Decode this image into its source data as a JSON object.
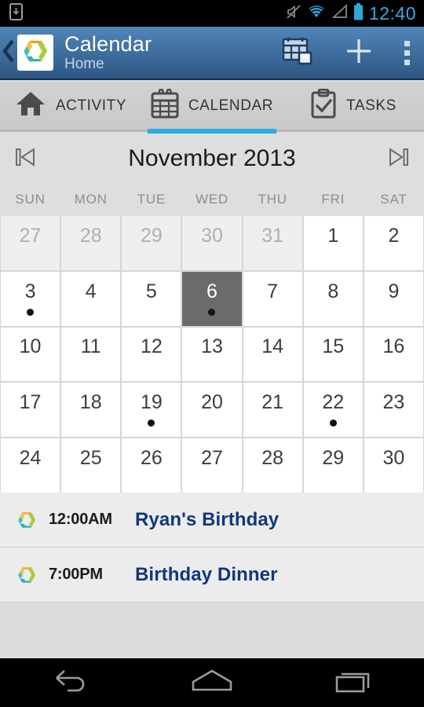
{
  "status_bar": {
    "clock": "12:40",
    "icons": [
      "download-icon",
      "mute-icon",
      "wifi-icon",
      "signal-icon",
      "battery-icon"
    ],
    "clock_color": "#3aabe0"
  },
  "action_bar": {
    "up_icon": "chevron-left-icon",
    "logo_icon": "app-logo-hexagon-icon",
    "title": "Calendar",
    "subtitle": "Home",
    "actions": [
      {
        "name": "month-view-icon",
        "label": "Month view"
      },
      {
        "name": "add-icon",
        "label": "Add"
      },
      {
        "name": "overflow-menu-icon",
        "label": "More options"
      }
    ],
    "gradient_top": "#5185bb",
    "gradient_bottom": "#2f5684"
  },
  "tabs": [
    {
      "id": "activity",
      "label": "ACTIVITY",
      "icon": "home-icon",
      "active": false
    },
    {
      "id": "calendar",
      "label": "CALENDAR",
      "icon": "calendar-icon",
      "active": true
    },
    {
      "id": "tasks",
      "label": "TASKS",
      "icon": "clipboard-check-icon",
      "active": false
    }
  ],
  "tab_indicator_color": "#29abe2",
  "month_bar": {
    "prev_icon": "skip-previous-icon",
    "next_icon": "skip-next-icon",
    "title": "November 2013"
  },
  "weekdays": [
    "SUN",
    "MON",
    "TUE",
    "WED",
    "THU",
    "FRI",
    "SAT"
  ],
  "calendar": {
    "selected_day": 6,
    "selected_bg": "#6b6b6b",
    "weeks": [
      [
        {
          "d": "27",
          "other": true,
          "dot": false
        },
        {
          "d": "28",
          "other": true,
          "dot": false
        },
        {
          "d": "29",
          "other": true,
          "dot": false
        },
        {
          "d": "30",
          "other": true,
          "dot": false
        },
        {
          "d": "31",
          "other": true,
          "dot": false
        },
        {
          "d": "1",
          "other": false,
          "dot": false
        },
        {
          "d": "2",
          "other": false,
          "dot": false
        }
      ],
      [
        {
          "d": "3",
          "other": false,
          "dot": true
        },
        {
          "d": "4",
          "other": false,
          "dot": false
        },
        {
          "d": "5",
          "other": false,
          "dot": false
        },
        {
          "d": "6",
          "other": false,
          "dot": true,
          "selected": true
        },
        {
          "d": "7",
          "other": false,
          "dot": false
        },
        {
          "d": "8",
          "other": false,
          "dot": false
        },
        {
          "d": "9",
          "other": false,
          "dot": false
        }
      ],
      [
        {
          "d": "10",
          "other": false,
          "dot": false
        },
        {
          "d": "11",
          "other": false,
          "dot": false
        },
        {
          "d": "12",
          "other": false,
          "dot": false
        },
        {
          "d": "13",
          "other": false,
          "dot": false
        },
        {
          "d": "14",
          "other": false,
          "dot": false
        },
        {
          "d": "15",
          "other": false,
          "dot": false
        },
        {
          "d": "16",
          "other": false,
          "dot": false
        }
      ],
      [
        {
          "d": "17",
          "other": false,
          "dot": false
        },
        {
          "d": "18",
          "other": false,
          "dot": false
        },
        {
          "d": "19",
          "other": false,
          "dot": true
        },
        {
          "d": "20",
          "other": false,
          "dot": false
        },
        {
          "d": "21",
          "other": false,
          "dot": false
        },
        {
          "d": "22",
          "other": false,
          "dot": true
        },
        {
          "d": "23",
          "other": false,
          "dot": false
        }
      ],
      [
        {
          "d": "24",
          "other": false,
          "dot": false
        },
        {
          "d": "25",
          "other": false,
          "dot": false
        },
        {
          "d": "26",
          "other": false,
          "dot": false
        },
        {
          "d": "27",
          "other": false,
          "dot": false
        },
        {
          "d": "28",
          "other": false,
          "dot": false
        },
        {
          "d": "29",
          "other": false,
          "dot": false
        },
        {
          "d": "30",
          "other": false,
          "dot": false
        }
      ]
    ]
  },
  "events": [
    {
      "icon": "app-logo-hexagon-icon",
      "time": "12:00AM",
      "title": "Ryan's Birthday"
    },
    {
      "icon": "app-logo-hexagon-icon",
      "time": "7:00PM",
      "title": "Birthday Dinner"
    }
  ],
  "event_title_color": "#10377b",
  "nav_bar": [
    {
      "name": "back-icon",
      "label": "Back"
    },
    {
      "name": "home-icon",
      "label": "Home"
    },
    {
      "name": "recents-icon",
      "label": "Recents"
    }
  ]
}
